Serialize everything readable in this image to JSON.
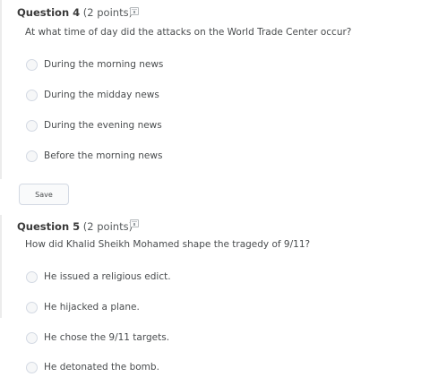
{
  "questions": [
    {
      "number_label": "Question 4",
      "points": "(2 points)",
      "prompt": "At what time of day did the attacks on the World Trade Center occur?",
      "options": [
        "During the morning news",
        "During the midday news",
        "During the evening news",
        "Before the morning news"
      ],
      "save_label": "Save"
    },
    {
      "number_label": "Question 5",
      "points": "(2 points)",
      "prompt": "How did Khalid Sheikh Mohamed shape the tragedy of 9/11?",
      "options": [
        "He issued a religious edict.",
        "He hijacked a plane.",
        "He chose the 9/11 targets.",
        "He detonated the bomb."
      ]
    }
  ]
}
